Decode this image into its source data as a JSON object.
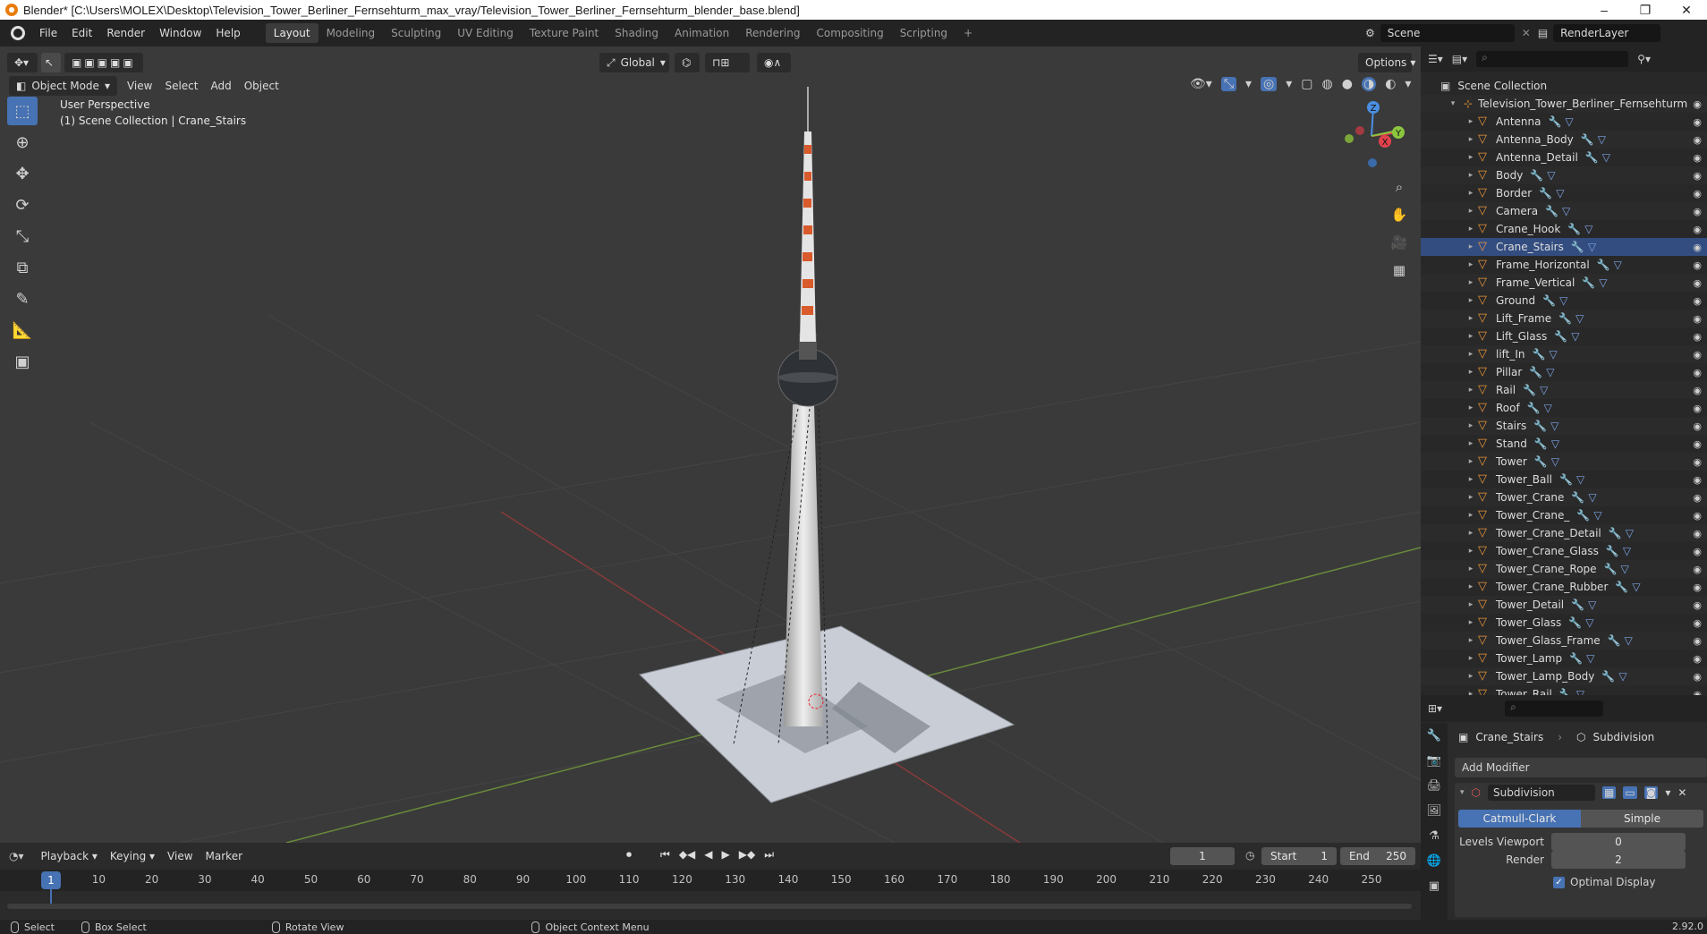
{
  "window": {
    "title": "Blender* [C:\\Users\\MOLEX\\Desktop\\Television_Tower_Berliner_Fernsehturm_max_vray/Television_Tower_Berliner_Fernsehturm_blender_base.blend]",
    "minimize": "–",
    "restore": "❐",
    "close": "✕"
  },
  "menu": [
    "File",
    "Edit",
    "Render",
    "Window",
    "Help"
  ],
  "workspaces": [
    "Layout",
    "Modeling",
    "Sculpting",
    "UV Editing",
    "Texture Paint",
    "Shading",
    "Animation",
    "Rendering",
    "Compositing",
    "Scripting",
    "+"
  ],
  "scene": {
    "name": "Scene",
    "render_layer": "RenderLayer"
  },
  "viewport": {
    "mode": "Object Mode",
    "menus": [
      "View",
      "Select",
      "Add",
      "Object"
    ],
    "transform": "Global",
    "options": "Options",
    "perspective": "User Perspective",
    "collection_info": "(1) Scene Collection | Crane_Stairs",
    "gizmo": {
      "x": "X",
      "y": "Y",
      "z": "Z"
    }
  },
  "outliner": {
    "root": "Scene Collection",
    "collection": "Television_Tower_Berliner_Fernsehturm",
    "items": [
      "Antenna",
      "Antenna_Body",
      "Antenna_Detail",
      "Body",
      "Border",
      "Camera",
      "Crane_Hook",
      "Crane_Stairs",
      "Frame_Horizontal",
      "Frame_Vertical",
      "Ground",
      "Lift_Frame",
      "Lift_Glass",
      "lift_In",
      "Pillar",
      "Rail",
      "Roof",
      "Stairs",
      "Stand",
      "Tower",
      "Tower_Ball",
      "Tower_Crane",
      "Tower_Crane_",
      "Tower_Crane_Detail",
      "Tower_Crane_Glass",
      "Tower_Crane_Rope",
      "Tower_Crane_Rubber",
      "Tower_Detail",
      "Tower_Glass",
      "Tower_Glass_Frame",
      "Tower_Lamp",
      "Tower_Lamp_Body",
      "Tower_Rail"
    ],
    "selected": "Crane_Stairs"
  },
  "properties": {
    "object": "Crane_Stairs",
    "modifier_crumb": "Subdivision",
    "add_modifier": "Add Modifier",
    "modifier_name": "Subdivision",
    "mode_catmull": "Catmull-Clark",
    "mode_simple": "Simple",
    "levels_viewport_label": "Levels Viewport",
    "levels_viewport": "0",
    "render_label": "Render",
    "render_value": "2",
    "optimal_display": "Optimal Display"
  },
  "timeline": {
    "menus": [
      "Playback",
      "Keying",
      "View",
      "Marker"
    ],
    "current_frame": "1",
    "start_label": "Start",
    "start": "1",
    "end_label": "End",
    "end": "250",
    "ticks": [
      "10",
      "20",
      "30",
      "40",
      "50",
      "60",
      "70",
      "80",
      "90",
      "100",
      "110",
      "120",
      "130",
      "140",
      "150",
      "160",
      "170",
      "180",
      "190",
      "200",
      "210",
      "220",
      "230",
      "240",
      "250"
    ],
    "playhead": "1"
  },
  "statusbar": {
    "select": "Select",
    "box_select": "Box Select",
    "rotate_view": "Rotate View",
    "context_menu": "Object Context Menu",
    "version": "2.92.0"
  },
  "colors": {
    "accent": "#4772b3",
    "selected_row": "#334d80",
    "mesh_icon": "#e8943a",
    "x_axis": "#e2424c",
    "y_axis": "#8cc63f",
    "z_axis": "#4b8fe2"
  }
}
